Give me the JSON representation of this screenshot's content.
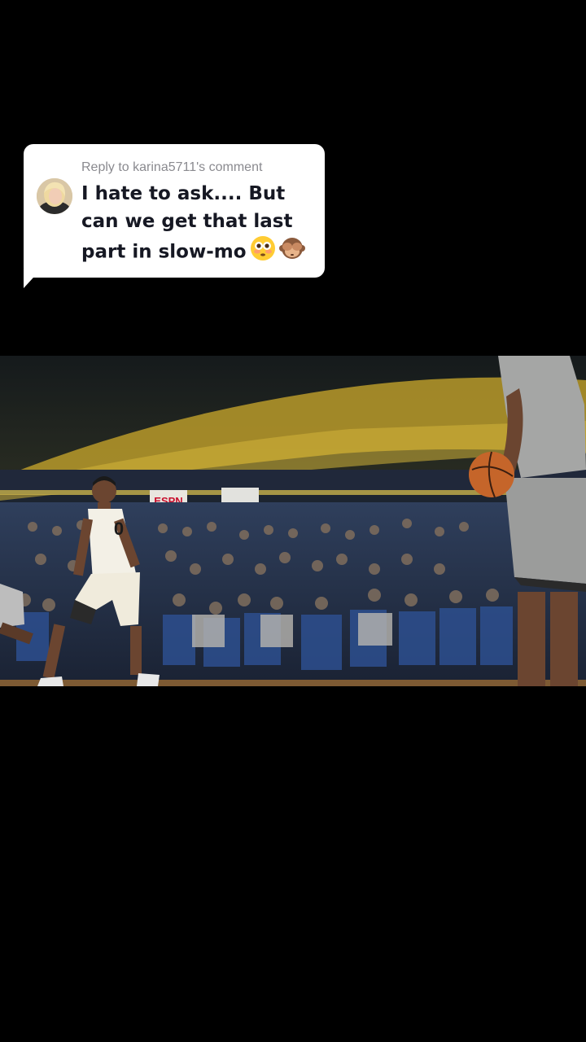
{
  "reply": {
    "header": "Reply to karina5711's comment",
    "text": "I hate to ask.... But can we get that last part in slow-mo",
    "emojis": [
      "flushed-face-emoji",
      "see-no-evil-monkey-emoji"
    ]
  },
  "video": {
    "banners": [
      "ESPN"
    ],
    "jersey_number": "0"
  },
  "colors": {
    "background": "#000000",
    "bubble": "#ffffff",
    "header_text": "#8a8a8f",
    "body_text": "#161823",
    "arena_gold": "#b89a2a",
    "seat_blue": "#1f3f7a"
  }
}
